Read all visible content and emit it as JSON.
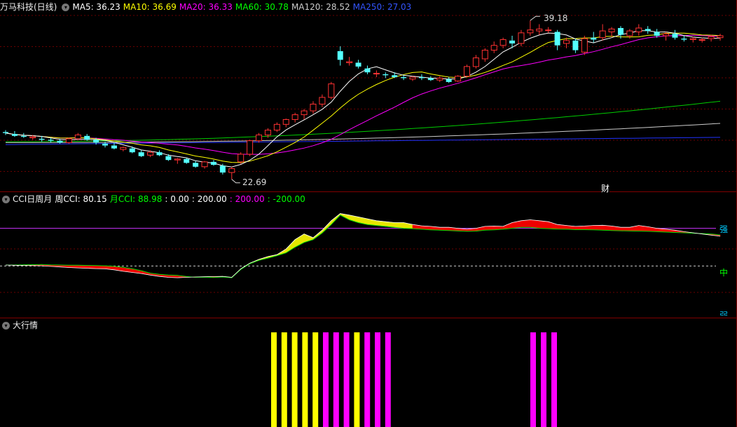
{
  "panel1": {
    "title": "万马科技(日线)",
    "ma": [
      {
        "label": "MA5: 36.23",
        "color": "#ffffff"
      },
      {
        "label": "MA10: 36.69",
        "color": "#ffff00"
      },
      {
        "label": "MA20: 36.33",
        "color": "#ff00ff"
      },
      {
        "label": "MA60: 30.78",
        "color": "#00ff00"
      },
      {
        "label": "MA120: 28.52",
        "color": "#cccccc"
      },
      {
        "label": "MA250: 27.03",
        "color": "#0000ff"
      }
    ],
    "high_label": "39.18",
    "low_label": "22.69",
    "cai_label": "财"
  },
  "panel2": {
    "title": "CCI日周月",
    "items": [
      {
        "label": "周CCI: 80.15",
        "color": "#ffffff"
      },
      {
        "label": "月CCI: 88.98",
        "color": "#00ff00"
      },
      {
        "label": ": 0.00",
        "color": "#ffffff"
      },
      {
        "label": ": 200.00",
        "color": "#ffffff"
      },
      {
        "label": ": 200.00",
        "color": "#ff00ff"
      },
      {
        "label": ": -200.00",
        "color": "#00ff00"
      }
    ],
    "strong_label": "强",
    "mid_label": "中",
    "weak_label": "弱"
  },
  "panel3": {
    "title": "大行情"
  },
  "chart_data": [
    {
      "type": "candlestick",
      "high_marked": 39.18,
      "low_marked": 22.69,
      "candles": [
        [
          27.6,
          27.8,
          27.3,
          27.5
        ],
        [
          27.4,
          27.7,
          27.1,
          27.2
        ],
        [
          27.2,
          27.5,
          27.0,
          27.1
        ],
        [
          27.0,
          27.3,
          26.8,
          27.1
        ],
        [
          26.9,
          27.2,
          26.6,
          26.8
        ],
        [
          26.8,
          27.0,
          26.5,
          26.7
        ],
        [
          26.7,
          26.9,
          26.4,
          26.5
        ],
        [
          26.5,
          27.0,
          26.4,
          26.9
        ],
        [
          26.9,
          27.5,
          26.8,
          27.3
        ],
        [
          27.2,
          27.4,
          26.7,
          26.8
        ],
        [
          26.8,
          27.0,
          26.3,
          26.5
        ],
        [
          26.4,
          26.6,
          26.0,
          26.2
        ],
        [
          26.2,
          26.5,
          25.8,
          25.9
        ],
        [
          25.8,
          26.1,
          25.6,
          26.0
        ],
        [
          25.9,
          26.1,
          25.4,
          25.5
        ],
        [
          25.5,
          25.7,
          25.0,
          25.1
        ],
        [
          25.2,
          25.7,
          25.0,
          25.5
        ],
        [
          25.5,
          25.7,
          25.1,
          25.2
        ],
        [
          25.1,
          25.3,
          24.6,
          24.7
        ],
        [
          24.7,
          24.9,
          24.3,
          24.8
        ],
        [
          24.8,
          24.9,
          24.3,
          24.4
        ],
        [
          24.4,
          24.6,
          23.9,
          24.0
        ],
        [
          24.0,
          24.6,
          23.8,
          24.5
        ],
        [
          24.5,
          24.7,
          24.1,
          24.2
        ],
        [
          24.1,
          24.3,
          23.2,
          23.4
        ],
        [
          23.4,
          24.0,
          22.69,
          23.8
        ],
        [
          24.5,
          25.5,
          24.3,
          25.3
        ],
        [
          25.3,
          26.8,
          25.1,
          26.7
        ],
        [
          26.7,
          27.5,
          26.5,
          27.3
        ],
        [
          27.3,
          28.0,
          27.0,
          27.8
        ],
        [
          27.8,
          28.6,
          27.6,
          28.4
        ],
        [
          28.4,
          29.0,
          28.1,
          28.9
        ],
        [
          28.9,
          29.6,
          28.6,
          29.4
        ],
        [
          29.4,
          30.0,
          28.9,
          29.8
        ],
        [
          29.8,
          30.8,
          29.5,
          30.5
        ],
        [
          30.5,
          31.5,
          30.2,
          31.2
        ],
        [
          31.2,
          32.8,
          31.0,
          32.6
        ],
        [
          36.0,
          36.5,
          34.5,
          35.1
        ],
        [
          34.8,
          35.4,
          34.5,
          34.9
        ],
        [
          34.8,
          35.1,
          34.2,
          34.4
        ],
        [
          34.2,
          34.5,
          33.6,
          33.8
        ],
        [
          33.7,
          34.0,
          33.3,
          33.7
        ],
        [
          33.6,
          33.8,
          33.2,
          33.5
        ],
        [
          33.5,
          33.8,
          33.2,
          33.3
        ],
        [
          33.3,
          33.5,
          33.0,
          33.2
        ],
        [
          33.1,
          33.4,
          32.9,
          33.3
        ],
        [
          33.3,
          33.6,
          33.0,
          33.2
        ],
        [
          33.2,
          33.4,
          32.9,
          33.0
        ],
        [
          33.0,
          33.4,
          32.8,
          33.2
        ],
        [
          33.1,
          33.3,
          32.7,
          32.8
        ],
        [
          32.9,
          33.5,
          32.8,
          33.4
        ],
        [
          33.4,
          34.6,
          33.3,
          34.4
        ],
        [
          34.4,
          35.6,
          34.2,
          35.3
        ],
        [
          35.2,
          36.3,
          34.9,
          36.1
        ],
        [
          36.1,
          37.0,
          35.8,
          36.6
        ],
        [
          36.6,
          37.4,
          36.3,
          37.2
        ],
        [
          37.1,
          37.6,
          36.3,
          36.8
        ],
        [
          36.8,
          38.2,
          36.5,
          37.9
        ],
        [
          37.9,
          39.18,
          37.6,
          38.2
        ],
        [
          38.1,
          38.8,
          37.7,
          38.3
        ],
        [
          38.2,
          38.5,
          37.9,
          38.2
        ],
        [
          38.0,
          38.2,
          36.1,
          36.6
        ],
        [
          36.8,
          37.4,
          36.3,
          37.1
        ],
        [
          37.1,
          37.3,
          35.8,
          36.1
        ],
        [
          35.9,
          37.6,
          35.6,
          37.3
        ],
        [
          37.4,
          38.0,
          36.9,
          37.2
        ],
        [
          37.4,
          38.8,
          37.1,
          38.1
        ],
        [
          38.0,
          38.5,
          37.5,
          38.3
        ],
        [
          38.4,
          38.6,
          37.3,
          37.7
        ],
        [
          37.6,
          38.3,
          37.3,
          38.1
        ],
        [
          38.0,
          38.8,
          37.6,
          38.4
        ],
        [
          38.3,
          38.6,
          37.8,
          38.1
        ],
        [
          38.0,
          38.3,
          37.4,
          37.6
        ],
        [
          37.6,
          38.0,
          37.1,
          37.8
        ],
        [
          37.8,
          38.2,
          37.2,
          37.4
        ],
        [
          37.3,
          37.6,
          37.0,
          37.2
        ],
        [
          37.2,
          37.5,
          36.9,
          37.3
        ],
        [
          37.2,
          37.4,
          36.9,
          37.2
        ],
        [
          37.3,
          37.7,
          37.0,
          37.5
        ],
        [
          37.4,
          37.8,
          37.1,
          37.6
        ]
      ]
    },
    {
      "type": "area",
      "title": "CCI日周月",
      "reference_lines": {
        "strong": 200,
        "mid": 0,
        "weak": -200
      },
      "series": [
        {
          "name": "周CCI",
          "values": [
            5,
            4,
            3,
            2,
            1,
            -2,
            -5,
            -8,
            -10,
            -12,
            -14,
            -15,
            -20,
            -28,
            -34,
            -40,
            -48,
            -55,
            -60,
            -62,
            -60,
            -58,
            -57,
            -56,
            -55,
            -60,
            -15,
            15,
            35,
            50,
            60,
            90,
            140,
            170,
            150,
            190,
            240,
            278,
            270,
            260,
            250,
            240,
            235,
            230,
            230,
            220,
            213,
            210,
            205,
            205,
            200,
            195,
            200,
            210,
            212,
            210,
            230,
            240,
            245,
            240,
            235,
            220,
            215,
            210,
            212,
            215,
            216,
            212,
            205,
            205,
            215,
            208,
            200,
            195,
            190,
            182,
            176,
            170,
            164,
            158
          ]
        },
        {
          "name": "月CCI",
          "values": [
            5,
            5,
            6,
            7,
            8,
            6,
            5,
            4,
            4,
            3,
            2,
            1,
            -2,
            -7,
            -15,
            -25,
            -38,
            -44,
            -48,
            -50,
            -56,
            -60,
            -59,
            -61,
            -58,
            -62,
            -18,
            12,
            30,
            42,
            55,
            70,
            100,
            125,
            140,
            175,
            220,
            270,
            245,
            230,
            220,
            215,
            210,
            205,
            200,
            198,
            195,
            192,
            190,
            188,
            186,
            184,
            185,
            190,
            192,
            195,
            200,
            205,
            205,
            200,
            198,
            196,
            195,
            193,
            193,
            192,
            190,
            188,
            187,
            186,
            185,
            184,
            182,
            180,
            178,
            176,
            174,
            172,
            170,
            165
          ]
        }
      ]
    },
    {
      "type": "bar",
      "title": "大行情",
      "bars": [
        {
          "index": 0,
          "color": "#ffff00"
        },
        {
          "index": 1,
          "color": "#ffff00"
        },
        {
          "index": 2,
          "color": "#ffff00"
        },
        {
          "index": 3,
          "color": "#ffff00"
        },
        {
          "index": 4,
          "color": "#ffff00"
        },
        {
          "index": 5,
          "color": "#ff00ff"
        },
        {
          "index": 6,
          "color": "#ff00ff"
        },
        {
          "index": 7,
          "color": "#ff00ff"
        },
        {
          "index": 8,
          "color": "#ffff00"
        },
        {
          "index": 9,
          "color": "#ff00ff"
        },
        {
          "index": 10,
          "color": "#ff00ff"
        },
        {
          "index": 11,
          "color": "#ff00ff"
        },
        {
          "index": 50,
          "color": "#ff00ff"
        },
        {
          "index": 51,
          "color": "#ff00ff"
        },
        {
          "index": 52,
          "color": "#ff00ff"
        }
      ]
    }
  ]
}
